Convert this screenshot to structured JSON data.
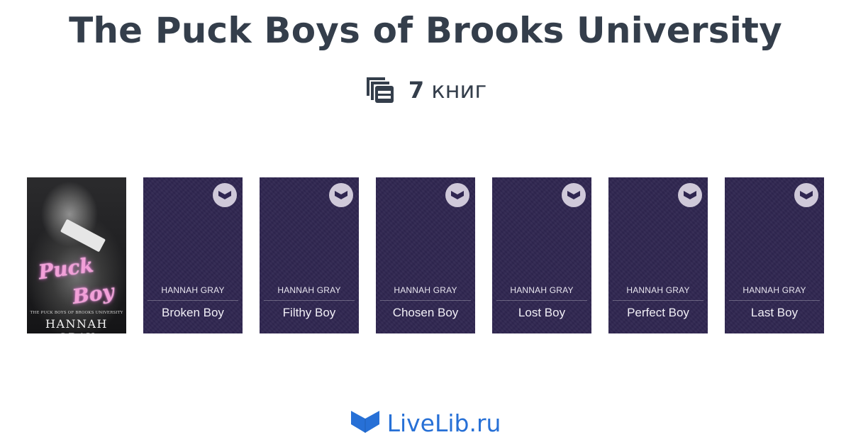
{
  "header": {
    "title": "The Puck Boys of Brooks University",
    "count_number": "7",
    "count_label": "книг",
    "icon": "books-stack-icon"
  },
  "cover": {
    "script_line1": "Puck",
    "script_line2": "Boy",
    "series_line": "THE PUCK BOYS OF BROOKS UNIVERSITY",
    "author": "HANNAH GRAY"
  },
  "books": [
    {
      "author": "HANNAH GRAY",
      "title": "Broken Boy"
    },
    {
      "author": "HANNAH GRAY",
      "title": "Filthy Boy"
    },
    {
      "author": "HANNAH GRAY",
      "title": "Chosen Boy"
    },
    {
      "author": "HANNAH GRAY",
      "title": "Lost Boy"
    },
    {
      "author": "HANNAH GRAY",
      "title": "Perfect Boy"
    },
    {
      "author": "HANNAH GRAY",
      "title": "Last Boy"
    }
  ],
  "footer": {
    "brand": "LiveLib.ru",
    "logo_icon": "open-book-logo-icon"
  },
  "colors": {
    "title": "#343e4b",
    "placeholder_cover": "#2f2650",
    "brand": "#2770d6"
  }
}
